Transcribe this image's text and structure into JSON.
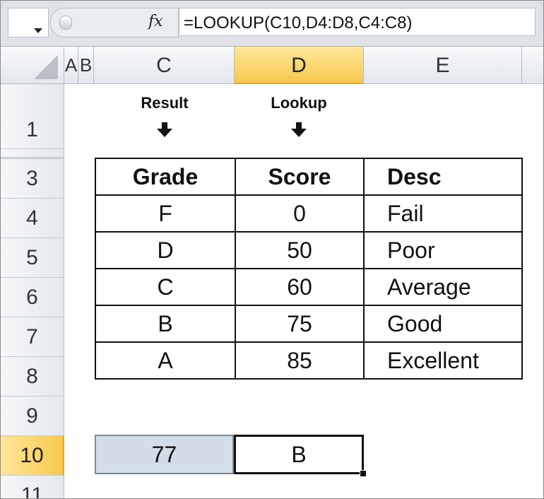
{
  "formula_bar": {
    "fx_label": "fx",
    "formula": "=LOOKUP(C10,D4:D8,C4:C8)",
    "name_box_value": ""
  },
  "columns": [
    {
      "id": "A",
      "label": "A"
    },
    {
      "id": "B",
      "label": "B"
    },
    {
      "id": "C",
      "label": "C"
    },
    {
      "id": "D",
      "label": "D"
    },
    {
      "id": "E",
      "label": "E"
    }
  ],
  "rows": [
    {
      "id": "1",
      "label": "1"
    },
    {
      "id": "3",
      "label": "3"
    },
    {
      "id": "4",
      "label": "4"
    },
    {
      "id": "5",
      "label": "5"
    },
    {
      "id": "6",
      "label": "6"
    },
    {
      "id": "7",
      "label": "7"
    },
    {
      "id": "8",
      "label": "8"
    },
    {
      "id": "9",
      "label": "9"
    },
    {
      "id": "10",
      "label": "10"
    },
    {
      "id": "11",
      "label": "11"
    }
  ],
  "labels": {
    "result": "Result",
    "lookup": "Lookup"
  },
  "table": {
    "headers": [
      "Grade",
      "Score",
      "Desc"
    ],
    "rows": [
      [
        "F",
        "0",
        "Fail"
      ],
      [
        "D",
        "50",
        "Poor"
      ],
      [
        "C",
        "60",
        "Average"
      ],
      [
        "B",
        "75",
        "Good"
      ],
      [
        "A",
        "85",
        "Excellent"
      ]
    ]
  },
  "row10": {
    "c10": "77",
    "d10": "B"
  },
  "colors": {
    "selected_header": "#f6c94d",
    "input_cell_fill": "#d3dde7"
  }
}
